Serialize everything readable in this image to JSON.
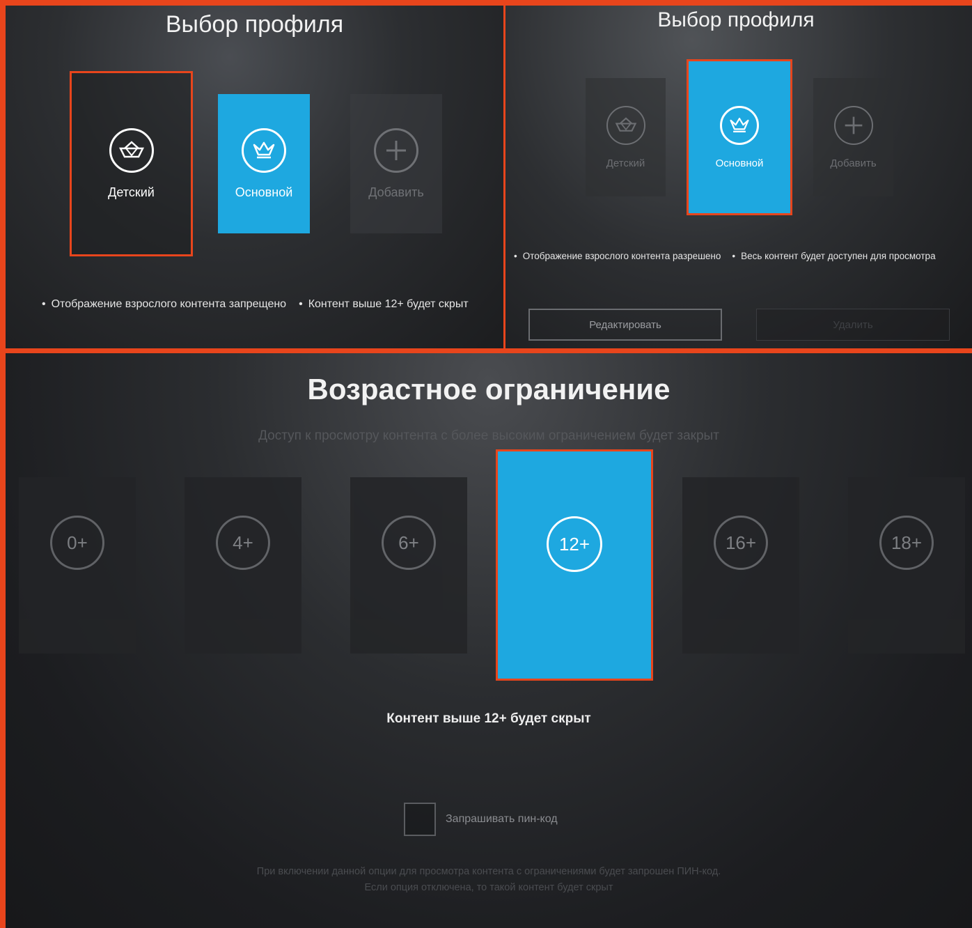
{
  "panel_top_left": {
    "title": "Выбор профиля",
    "profiles": [
      {
        "label": "Детский",
        "icon": "boat-icon",
        "state": "focused"
      },
      {
        "label": "Основной",
        "icon": "crown-icon",
        "state": "active"
      },
      {
        "label": "Добавить",
        "icon": "plus-icon",
        "state": "normal"
      }
    ],
    "bullets": [
      "Отображение взрослого контента запрещено",
      "Контент выше 12+ будет скрыт"
    ]
  },
  "panel_top_right": {
    "title": "Выбор профиля",
    "profiles": [
      {
        "label": "Детский",
        "icon": "boat-icon",
        "state": "dim"
      },
      {
        "label": "Основной",
        "icon": "crown-icon",
        "state": "focused-active"
      },
      {
        "label": "Добавить",
        "icon": "plus-icon",
        "state": "dim"
      }
    ],
    "bullets": [
      "Отображение взрослого контента разрешено",
      "Весь контент будет доступен для просмотра"
    ],
    "edit_button": "Редактировать",
    "delete_button": "Удалить"
  },
  "panel_bottom": {
    "title": "Возрастное ограничение",
    "subtitle": "Доступ к просмотру контента с более высоким ограничением будет закрыт",
    "ages": [
      "0+",
      "4+",
      "6+",
      "12+",
      "16+",
      "18+"
    ],
    "selected_age": "12+",
    "selected_note": "Контент выше 12+ будет скрыт",
    "pin_label": "Запрашивать пин-код",
    "pin_checked": false,
    "footnote_line1": "При включении данной опции для просмотра контента с ограничениями будет запрошен ПИН-код.",
    "footnote_line2": "Если опция отключена, то такой контент будет скрыт"
  },
  "colors": {
    "accent": "#1ea8e0",
    "highlight": "#e8451c"
  }
}
